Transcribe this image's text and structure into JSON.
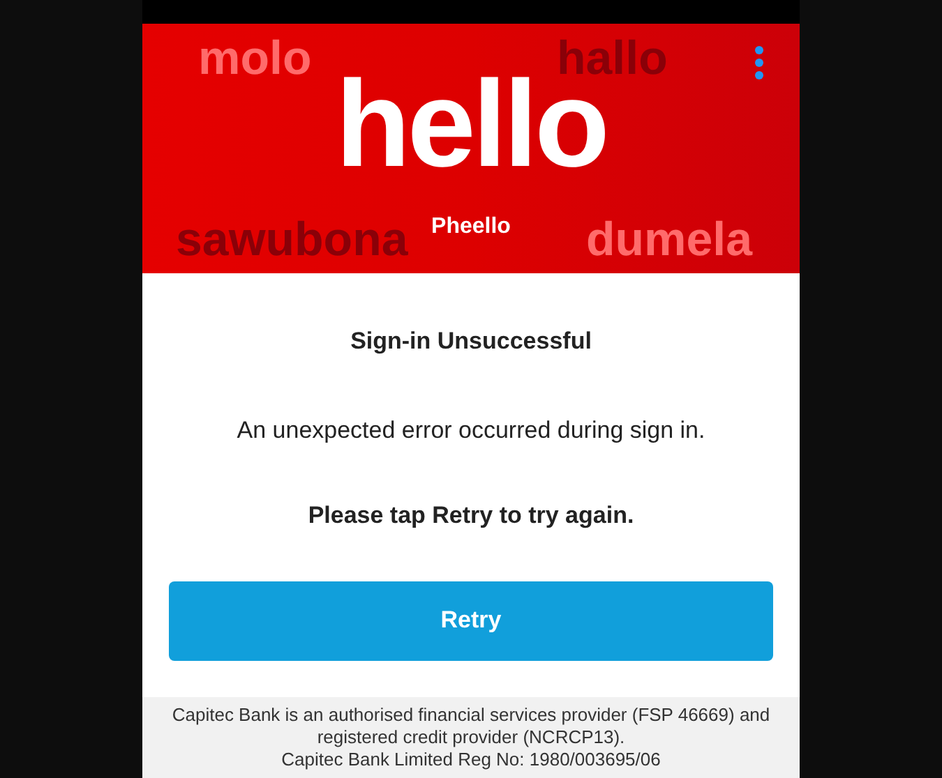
{
  "banner": {
    "title": "hello",
    "subtitle": "Pheello",
    "background_words": [
      {
        "text": "molo",
        "color": "#ff6b6b"
      },
      {
        "text": "hallo",
        "color": "#8a0008"
      },
      {
        "text": "sawubona",
        "color": "#8a0008"
      },
      {
        "text": "dumela",
        "color": "#ff6b6b"
      }
    ]
  },
  "dialog": {
    "title": "Sign-in Unsuccessful",
    "message": "An unexpected error occurred during sign in.",
    "instruction": "Please tap Retry to try again.",
    "button": "Retry"
  },
  "footer": {
    "lines": [
      "Capitec Bank is an authorised financial services provider (FSP 46669) and registered credit provider (NCRCP13).",
      "Capitec Bank Limited Reg No: 1980/003695/06"
    ]
  }
}
